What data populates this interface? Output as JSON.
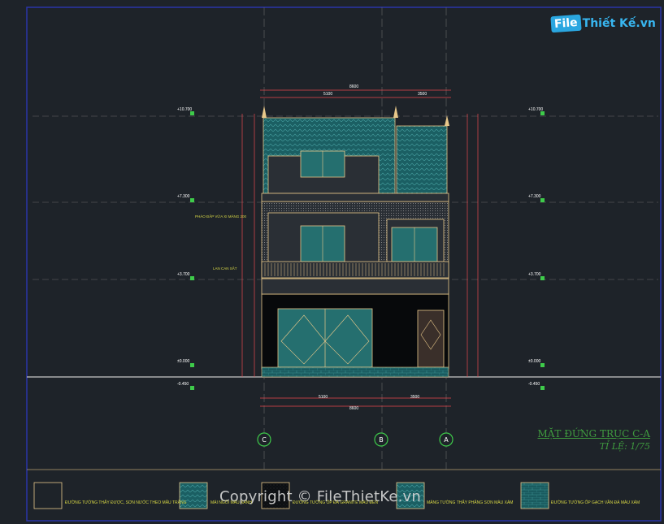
{
  "brand": {
    "logo_prefix": "File",
    "logo_rest": "Thiết Kế.vn"
  },
  "drawing": {
    "title": "MẶT ĐỨNG TRỤC C-A",
    "scale": "TỈ LỆ: 1/75",
    "copyright": "Copyright © FileThietKe.vn",
    "grid_axes": [
      {
        "label": "C"
      },
      {
        "label": "B"
      },
      {
        "label": "A"
      }
    ],
    "level_marks_left": [
      "+10.700",
      "+7.300",
      "+3.700",
      "±0.000",
      "-0.450"
    ],
    "level_marks_right": [
      "+10.700",
      "+7.300",
      "+3.700",
      "±0.000",
      "-0.450"
    ],
    "top_dims": {
      "overall": "8600",
      "left": "5100",
      "right": "3500"
    },
    "bottom_dims": {
      "overall": "8600",
      "left": "5100",
      "right": "3500"
    },
    "side_notes": {
      "note_1": "PHÀO ĐẮP VỮA XI MĂNG 200",
      "note_2": "LAN CAN SẮT"
    }
  },
  "legend": [
    {
      "label": "ĐƯỜNG TƯỜNG THẤY ĐƯỢC, SƠN NƯỚC THEO MẪU TRẮNG",
      "pattern": "empty"
    },
    {
      "label": "MÁI NGÓI MÀU XANH",
      "pattern": "roof"
    },
    {
      "label": "ĐƯỜNG TƯỜNG ỐP ĐÁ GRANITE MÀU ĐEN",
      "pattern": "granite"
    },
    {
      "label": "MẢNG TƯỜNG THẤY PHẲNG SƠN MÀU XÁM",
      "pattern": "hatch"
    },
    {
      "label": "ĐƯỜNG TƯỜNG ỐP GẠCH VẦN ĐÁ MÀU XÁM",
      "pattern": "brick"
    }
  ],
  "colors": {
    "background": "#1e2329",
    "frame": "#2a35a8",
    "wall": "#e8c88a",
    "dimension": "#e8484e",
    "label_green": "#3ecb4a",
    "roof": "#1f6f73",
    "glass": "#2f8c8c"
  }
}
